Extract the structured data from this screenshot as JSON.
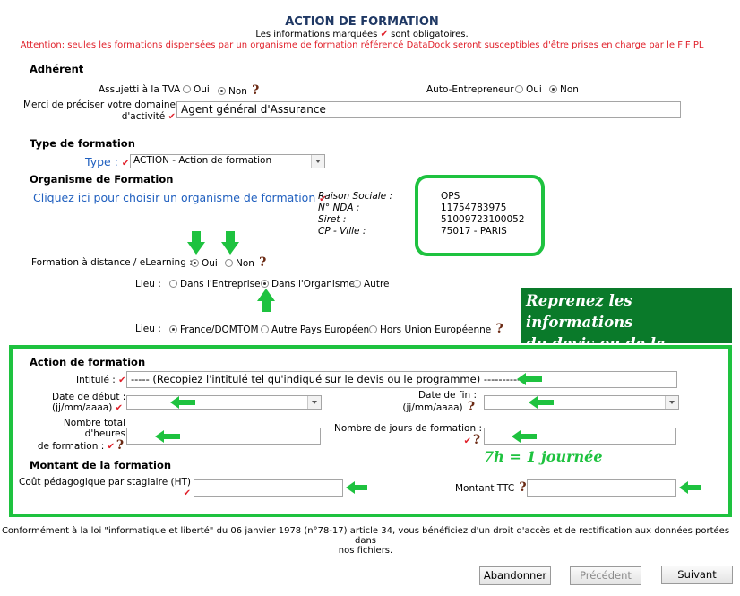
{
  "header": {
    "title": "ACTION DE FORMATION",
    "required_note_before": "Les informations marquées",
    "required_note_after": "sont obligatoires.",
    "warning": "Attention: seules les formations dispensées par un organisme de formation référencé DataDock seront susceptibles d'être prises en charge par le FIF PL"
  },
  "adherent": {
    "section_title": "Adhérent",
    "tva_label": "Assujetti à la TVA",
    "tva_options": [
      "Oui",
      "Non"
    ],
    "tva_selected": "Non",
    "auto_label": "Auto-Entrepreneur",
    "auto_options": [
      "Oui",
      "Non"
    ],
    "auto_selected": "Non",
    "domain_label_line1": "Merci de préciser votre domaine",
    "domain_label_line2": "d'activité",
    "domain_value": "Agent général d'Assurance"
  },
  "type_formation": {
    "section_title": "Type de formation",
    "type_label": "Type :",
    "type_value": "ACTION - Action de formation"
  },
  "organisme": {
    "section_title": "Organisme de Formation",
    "choose_link": "Cliquez ici pour choisir un organisme de formation",
    "raison_label": "Raison Sociale :",
    "raison_value": "OPS",
    "nda_label": "N° NDA :",
    "nda_value": "11754783975",
    "siret_label": "Siret :",
    "siret_value": "51009723100052",
    "cp_label": "CP - Ville :",
    "cp_value": "75017 - PARIS"
  },
  "distance": {
    "label": "Formation à distance / eLearning :",
    "options": [
      "Oui",
      "Non"
    ],
    "selected": "Oui"
  },
  "lieu": {
    "label": "Lieu :",
    "options": [
      "Dans l'Entreprise",
      "Dans l'Organisme",
      "Autre"
    ],
    "selected": "Dans l'Organisme"
  },
  "lieu2": {
    "label": "Lieu :",
    "options": [
      "France/DOMTOM",
      "Autre Pays Européen",
      "Hors Union Européenne"
    ],
    "selected": "France/DOMTOM"
  },
  "callout": {
    "line1": "Reprenez les informations",
    "line2": "du devis ou de la facture"
  },
  "action": {
    "section_title": "Action de formation",
    "intitule_label": "Intitulé :",
    "intitule_value": "----- (Recopiez l'intitulé tel qu'indiqué sur le devis ou le programme) ----------",
    "date_debut_line1": "Date de début :",
    "date_debut_line2": "(jj/mm/aaaa)",
    "date_fin_line1": "Date de fin :",
    "date_fin_line2": "(jj/mm/aaaa)",
    "heures_line1": "Nombre total",
    "heures_line2": "d'heures",
    "heures_line3": "de formation :",
    "jours_label": "Nombre de jours de formation :",
    "journee_note": "7h = 1 journée"
  },
  "montant": {
    "section_title": "Montant de la formation",
    "cout_label": "Coût pédagogique par stagiaire (HT)",
    "ttc_label": "Montant TTC"
  },
  "footer": {
    "text_line1": "Conformément à la loi \"informatique et liberté\" du 06 janvier 1978 (n°78-17) article 34, vous bénéficiez d'un droit d'accès et de rectification aux données portées dans",
    "text_line2": "nos fichiers."
  },
  "buttons": {
    "abandon": "Abandonner",
    "previous": "Précédent",
    "next": "Suivant"
  },
  "colors": {
    "required_check": "#e0202a",
    "highlight_green": "#1ec23f",
    "callout_bg": "#0a7a2a",
    "link_blue": "#1f5fbf"
  }
}
